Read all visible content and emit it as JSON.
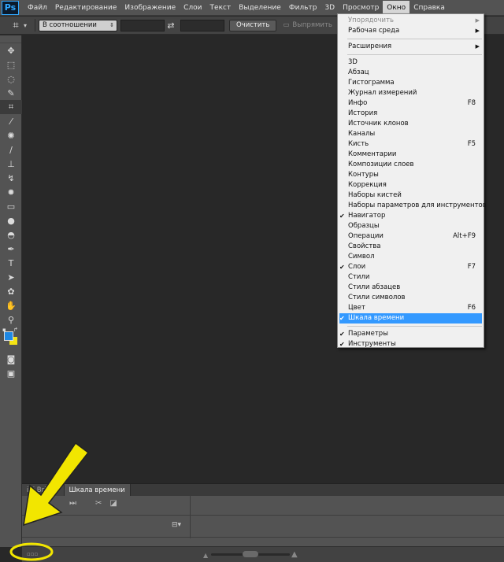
{
  "menubar": {
    "logo": "Ps",
    "items": [
      "Файл",
      "Редактирование",
      "Изображение",
      "Слои",
      "Текст",
      "Выделение",
      "Фильтр",
      "3D",
      "Просмотр",
      "Окно",
      "Справка"
    ]
  },
  "options": {
    "ratio_select": "В соотношении",
    "clear_button": "Очистить",
    "straighten_label": "Выпрямить"
  },
  "timeline": {
    "tabs": [
      "ini Bridge",
      "Шкала времени"
    ]
  },
  "window_menu": {
    "groups": [
      [
        {
          "label": "Упорядочить",
          "submenu": true,
          "disabled": true
        },
        {
          "label": "Рабочая среда",
          "submenu": true
        }
      ],
      [
        {
          "label": "Расширения",
          "submenu": true
        }
      ],
      [
        {
          "label": "3D"
        },
        {
          "label": "Абзац"
        },
        {
          "label": "Гистограмма"
        },
        {
          "label": "Журнал измерений"
        },
        {
          "label": "Инфо",
          "shortcut": "F8"
        },
        {
          "label": "История"
        },
        {
          "label": "Источник клонов"
        },
        {
          "label": "Каналы"
        },
        {
          "label": "Кисть",
          "shortcut": "F5"
        },
        {
          "label": "Комментарии"
        },
        {
          "label": "Композиции слоев"
        },
        {
          "label": "Контуры"
        },
        {
          "label": "Коррекция"
        },
        {
          "label": "Наборы кистей"
        },
        {
          "label": "Наборы параметров для инструментов"
        },
        {
          "label": "Навигатор",
          "checked": true
        },
        {
          "label": "Образцы"
        },
        {
          "label": "Операции",
          "shortcut": "Alt+F9"
        },
        {
          "label": "Свойства"
        },
        {
          "label": "Символ"
        },
        {
          "label": "Слои",
          "shortcut": "F7",
          "checked": true
        },
        {
          "label": "Стили"
        },
        {
          "label": "Стили абзацев"
        },
        {
          "label": "Стили символов"
        },
        {
          "label": "Цвет",
          "shortcut": "F6"
        },
        {
          "label": "Шкала времени",
          "checked": true,
          "highlighted": true
        }
      ],
      [
        {
          "label": "Параметры",
          "checked": true
        },
        {
          "label": "Инструменты",
          "checked": true
        }
      ]
    ]
  },
  "colors": {
    "foreground": "#1e88e5",
    "background": "#f5e414",
    "menu_highlight": "#3399ff",
    "annotation": "#f2e600"
  }
}
